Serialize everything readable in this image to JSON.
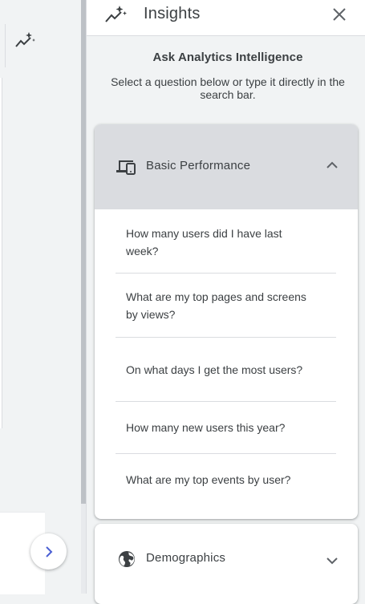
{
  "panel": {
    "title": "Insights",
    "intro_title": "Ask Analytics Intelligence",
    "intro_text": "Select a question below or type it directly in the search bar."
  },
  "sections": [
    {
      "label": "Basic Performance",
      "icon": "devices-icon",
      "expanded": true,
      "questions": [
        "How many users did I have last week?",
        "What are my top pages and screens by views?",
        "On what days I get the most users?",
        "How many new users this year?",
        "What are my top events by user?"
      ]
    },
    {
      "label": "Demographics",
      "icon": "globe-icon",
      "expanded": false
    }
  ],
  "colors": {
    "header_bg": "#dadce0",
    "panel_bg": "#f1f3f4",
    "accent_blue": "#1a73e8"
  }
}
